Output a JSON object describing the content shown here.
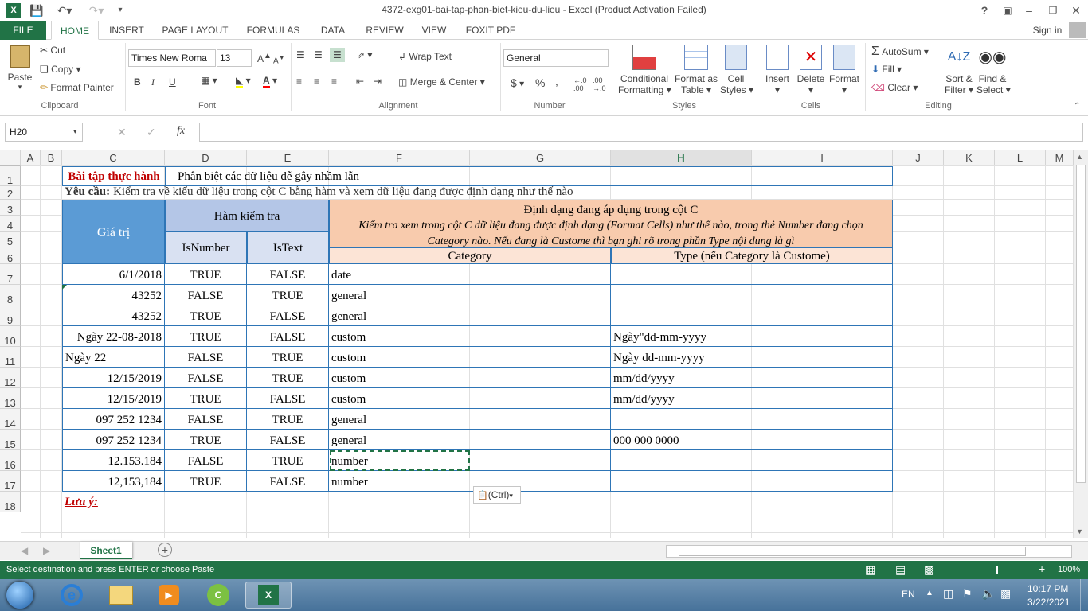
{
  "window": {
    "title": "4372-exg01-bai-tap-phan-biet-kieu-du-lieu - Excel (Product Activation Failed)",
    "help": "?",
    "sign_in": "Sign in"
  },
  "tabs": [
    "FILE",
    "HOME",
    "INSERT",
    "PAGE LAYOUT",
    "FORMULAS",
    "DATA",
    "REVIEW",
    "VIEW",
    "FOXIT PDF"
  ],
  "ribbon": {
    "clipboard": {
      "paste": "Paste",
      "cut": "Cut",
      "copy": "Copy",
      "format_painter": "Format Painter",
      "label": "Clipboard"
    },
    "font": {
      "name": "Times New Roma",
      "size": "13",
      "bold": "B",
      "italic": "I",
      "underline": "U",
      "label": "Font"
    },
    "alignment": {
      "wrap": "Wrap Text",
      "merge": "Merge & Center",
      "label": "Alignment"
    },
    "number": {
      "format": "General",
      "currency": "$",
      "percent": "%",
      "comma": ",",
      "label": "Number"
    },
    "styles": {
      "conditional": "Conditional",
      "conditional2": "Formatting",
      "format_as": "Format as",
      "format_as2": "Table",
      "cell": "Cell",
      "cell2": "Styles",
      "label": "Styles"
    },
    "cells": {
      "insert": "Insert",
      "delete": "Delete",
      "format": "Format",
      "label": "Cells"
    },
    "editing": {
      "autosum": "AutoSum",
      "fill": "Fill",
      "clear": "Clear",
      "sort": "Sort &",
      "sort2": "Filter",
      "find": "Find &",
      "find2": "Select",
      "label": "Editing"
    }
  },
  "formula_bar": {
    "name_box": "H20",
    "fx": "fx",
    "value": ""
  },
  "columns": [
    "A",
    "B",
    "C",
    "D",
    "E",
    "F",
    "G",
    "H",
    "I",
    "J",
    "K",
    "L",
    "M"
  ],
  "rows": [
    "1",
    "2",
    "3",
    "4",
    "5",
    "6",
    "7",
    "8",
    "9",
    "10",
    "11",
    "12",
    "13",
    "14",
    "15",
    "16",
    "17",
    "18"
  ],
  "sheet": {
    "r1_title": "Bài tập thực hành",
    "r1_sub": "Phân biệt các dữ liệu dễ gây nhầm lẫn",
    "r2_req_label": "Yêu cầu:",
    "r2_req_text": "Kiểm tra về kiểu dữ liệu trong cột C bằng hàm và xem dữ liệu đang được định dạng như thế nào",
    "hdr_value": "Giá trị",
    "hdr_check": "Hàm kiểm tra",
    "hdr_isnumber": "IsNumber",
    "hdr_istext": "IsText",
    "hdr_format": "Định dạng đang áp dụng trong cột C",
    "hdr_format_desc": "Kiểm tra xem trong cột C dữ liệu đang được định dạng (Format Cells) như thế nào, trong thẻ Number đang chọn Category nào. Nếu đang là Custome thì bạn ghi rõ trong phần Type nội dung là gì",
    "hdr_category": "Category",
    "hdr_type": "Type (nếu Category là Custome)",
    "data": [
      {
        "value": "6/1/2018",
        "align": "r",
        "isnum": "TRUE",
        "istext": "FALSE",
        "cat": "date",
        "type": ""
      },
      {
        "value": "43252",
        "align": "r",
        "isnum": "FALSE",
        "istext": "TRUE",
        "cat": "general",
        "type": ""
      },
      {
        "value": "43252",
        "align": "r",
        "isnum": "TRUE",
        "istext": "FALSE",
        "cat": "general",
        "type": ""
      },
      {
        "value": "Ngày 22-08-2018",
        "align": "r",
        "isnum": "TRUE",
        "istext": "FALSE",
        "cat": "custom",
        "type": "Ngày\"dd-mm-yyyy"
      },
      {
        "value": "Ngày 22",
        "align": "l",
        "isnum": "FALSE",
        "istext": "TRUE",
        "cat": "custom",
        "type": "Ngày dd-mm-yyyy"
      },
      {
        "value": "12/15/2019",
        "align": "r",
        "isnum": "FALSE",
        "istext": "TRUE",
        "cat": "custom",
        "type": "mm/dd/yyyy"
      },
      {
        "value": "12/15/2019",
        "align": "r",
        "isnum": "TRUE",
        "istext": "FALSE",
        "cat": "custom",
        "type": "mm/dd/yyyy"
      },
      {
        "value": "097 252 1234",
        "align": "r",
        "isnum": "FALSE",
        "istext": "TRUE",
        "cat": "general",
        "type": ""
      },
      {
        "value": "097 252 1234",
        "align": "r",
        "isnum": "TRUE",
        "istext": "FALSE",
        "cat": "general",
        "type": "000 000 0000"
      },
      {
        "value": "12.153.184",
        "align": "r",
        "isnum": "FALSE",
        "istext": "TRUE",
        "cat": "number",
        "type": ""
      },
      {
        "value": "12,153,184",
        "align": "r",
        "isnum": "TRUE",
        "istext": "FALSE",
        "cat": "number",
        "type": ""
      }
    ],
    "r18_note": "Lưu ý:",
    "paste_options": "(Ctrl)"
  },
  "sheet_tab": "Sheet1",
  "status": {
    "message": "Select destination and press ENTER or choose Paste",
    "zoom": "100%"
  },
  "taskbar": {
    "lang": "EN",
    "time": "10:17 PM",
    "date": "3/22/2021"
  },
  "colors": {
    "excel_green": "#217346",
    "header_blue": "#5b9bd5",
    "header_lightblue": "#b4c6e7",
    "header_lightblue2": "#d9e1f2",
    "header_orange": "#f8cbad",
    "header_lightorange": "#fce4d6",
    "title_red": "#c00000"
  }
}
